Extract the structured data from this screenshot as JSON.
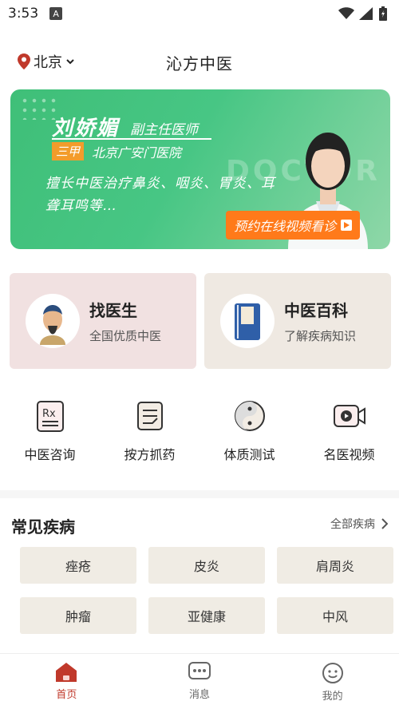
{
  "status": {
    "time": "3:53"
  },
  "header": {
    "city": "北京",
    "title": "沁方中医"
  },
  "banner": {
    "doctor_name": "刘娇媚",
    "doctor_rank": "副主任医师",
    "tag": "三甲",
    "hospital": "北京广安门医院",
    "description": "擅长中医治疗鼻炎、咽炎、胃炎、耳聋耳鸣等…",
    "cta": "预约在线视频看诊",
    "watermark": "DOCTOR"
  },
  "cards": [
    {
      "title": "找医生",
      "subtitle": "全国优质中医"
    },
    {
      "title": "中医百科",
      "subtitle": "了解疾病知识"
    }
  ],
  "services": [
    {
      "label": "中医咨询",
      "icon": "rx-prescription-icon"
    },
    {
      "label": "按方抓药",
      "icon": "prescription-note-icon"
    },
    {
      "label": "体质测试",
      "icon": "yin-yang-icon"
    },
    {
      "label": "名医视频",
      "icon": "video-camera-icon"
    }
  ],
  "diseases": {
    "title": "常见疾病",
    "more": "全部疾病",
    "items": [
      "痤疮",
      "皮炎",
      "肩周炎",
      "肿瘤",
      "亚健康",
      "中风"
    ]
  },
  "tabs": [
    {
      "label": "首页",
      "icon": "home-icon"
    },
    {
      "label": "消息",
      "icon": "message-icon"
    },
    {
      "label": "我的",
      "icon": "profile-icon"
    }
  ],
  "colors": {
    "accent": "#c0392b",
    "banner_green": "#47c684",
    "cta_orange": "#ff7a1a"
  }
}
